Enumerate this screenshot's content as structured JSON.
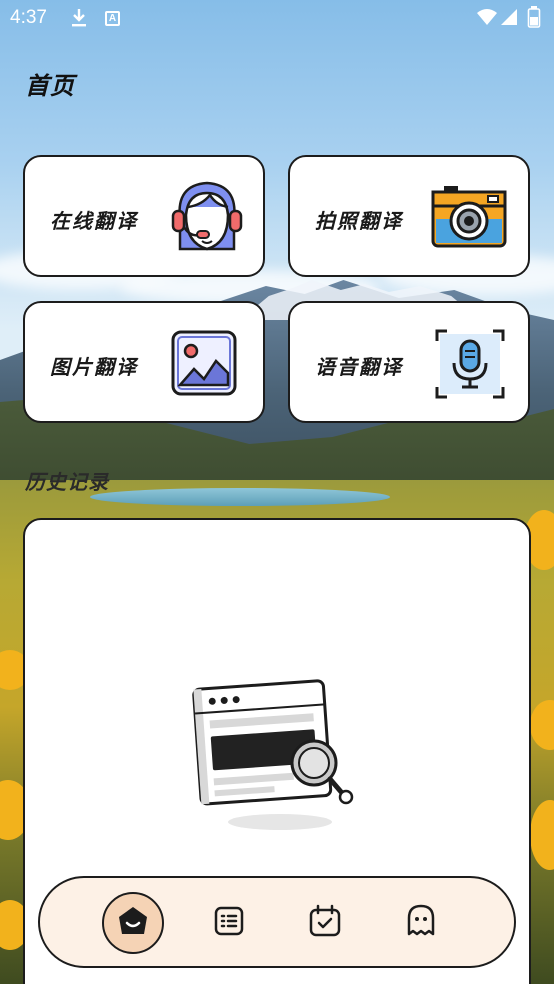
{
  "status_bar": {
    "time": "4:37",
    "icons": [
      "download-icon",
      "a-badge-icon",
      "wifi-icon",
      "signal-icon",
      "battery-icon"
    ],
    "badge_letter": "A"
  },
  "page": {
    "title": "首页"
  },
  "features": [
    {
      "label": "在线翻译",
      "icon": "support-agent-icon"
    },
    {
      "label": "拍照翻译",
      "icon": "camera-icon"
    },
    {
      "label": "图片翻译",
      "icon": "image-icon"
    },
    {
      "label": "语音翻译",
      "icon": "microphone-icon"
    }
  ],
  "history": {
    "title": "历史记录",
    "empty_state_icon": "browser-search-icon"
  },
  "tab_bar": {
    "active": "home",
    "tabs": [
      {
        "id": "home",
        "icon": "home-icon"
      },
      {
        "id": "list",
        "icon": "list-icon"
      },
      {
        "id": "calendar",
        "icon": "calendar-check-icon"
      },
      {
        "id": "ghost",
        "icon": "ghost-icon"
      }
    ]
  },
  "colors": {
    "card_border": "#1c1c1c",
    "tab_bar_bg": "#fdf1e6",
    "active_tab_bg": "#f5d3b5",
    "camera_body": "#f5a623",
    "camera_top": "#4aa3df",
    "agent_hair": "#7e8ff0",
    "agent_headset": "#f06b6b",
    "image_frame": "#6b76d8",
    "mic_bg": "#dcecfb"
  }
}
